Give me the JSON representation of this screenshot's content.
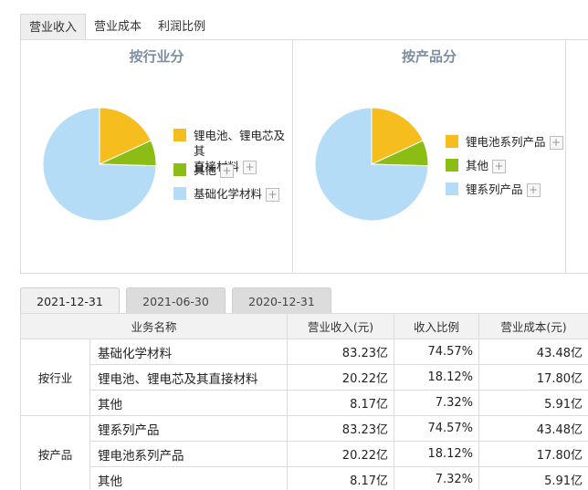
{
  "top_tabs": [
    {
      "label": "营业收入",
      "active": true
    },
    {
      "label": "营业成本",
      "active": false
    },
    {
      "label": "利润比例",
      "active": false
    }
  ],
  "charts": [
    {
      "title": "按行业分",
      "slices": [
        {
          "label_lines": [
            "锂电池、锂电芯及其",
            "直接材料"
          ],
          "value": 18.12,
          "color": "#f5be1e"
        },
        {
          "label_lines": [
            "其他"
          ],
          "value": 7.32,
          "color": "#8cbd14"
        },
        {
          "label_lines": [
            "基础化学材料"
          ],
          "value": 74.57,
          "color": "#b4dcf7"
        }
      ]
    },
    {
      "title": "按产品分",
      "slices": [
        {
          "label_lines": [
            "锂电池系列产品"
          ],
          "value": 18.12,
          "color": "#f5be1e"
        },
        {
          "label_lines": [
            "其他"
          ],
          "value": 7.32,
          "color": "#8cbd14"
        },
        {
          "label_lines": [
            "锂系列产品"
          ],
          "value": 74.57,
          "color": "#b4dcf7"
        }
      ]
    }
  ],
  "plus_symbol": "+",
  "date_tabs": [
    {
      "label": "2021-12-31",
      "active": true
    },
    {
      "label": "2021-06-30",
      "active": false
    },
    {
      "label": "2020-12-31",
      "active": false
    }
  ],
  "table": {
    "headers": [
      "业务名称",
      "营业收入(元)",
      "收入比例",
      "营业成本(元)"
    ],
    "groups": [
      {
        "name": "按行业",
        "rows": [
          {
            "name": "基础化学材料",
            "revenue": "83.23亿",
            "ratio": "74.57%",
            "cost": "43.48亿"
          },
          {
            "name": "锂电池、锂电芯及其直接材料",
            "revenue": "20.22亿",
            "ratio": "18.12%",
            "cost": "17.80亿"
          },
          {
            "name": "其他",
            "revenue": "8.17亿",
            "ratio": "7.32%",
            "cost": "5.91亿"
          }
        ]
      },
      {
        "name": "按产品",
        "rows": [
          {
            "name": "锂系列产品",
            "revenue": "83.23亿",
            "ratio": "74.57%",
            "cost": "43.48亿"
          },
          {
            "name": "锂电池系列产品",
            "revenue": "20.22亿",
            "ratio": "18.12%",
            "cost": "17.80亿"
          },
          {
            "name": "其他",
            "revenue": "8.17亿",
            "ratio": "7.32%",
            "cost": "5.91亿"
          }
        ]
      }
    ]
  }
}
